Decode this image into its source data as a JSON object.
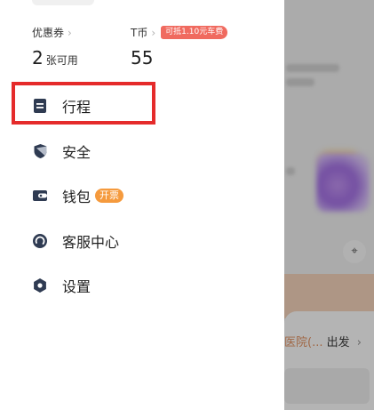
{
  "drawer": {
    "stats": {
      "coupon": {
        "label": "优惠券",
        "value": "2",
        "unit": "张可用"
      },
      "tcoin": {
        "label": "T币",
        "badge": "可抵1.10元车费",
        "value": "55"
      }
    },
    "menu": [
      {
        "label": "行程",
        "icon": "trip-list-icon"
      },
      {
        "label": "安全",
        "icon": "shield-icon"
      },
      {
        "label": "钱包",
        "icon": "wallet-icon",
        "badge": "开票"
      },
      {
        "label": "客服中心",
        "icon": "customer-service-icon"
      },
      {
        "label": "设置",
        "icon": "settings-gear-icon"
      }
    ]
  },
  "background": {
    "destination_text": "医院(...",
    "go_label": "出发",
    "chevron": "›",
    "locate_glyph": "⌖"
  },
  "colors": {
    "accent_orange": "#f59a3d",
    "promo_red": "#f06a5f",
    "highlight_red": "#e52b2b",
    "icon_dark": "#2f3b52"
  }
}
